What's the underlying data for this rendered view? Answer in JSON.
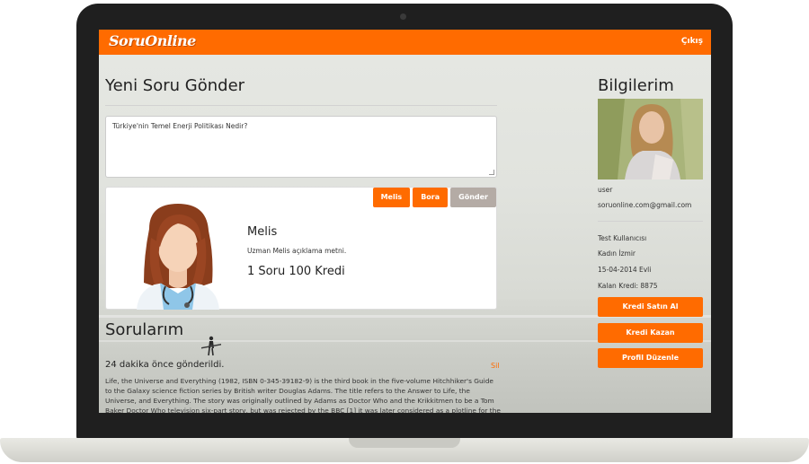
{
  "header": {
    "logo": "SoruOnline",
    "logout_label": "Çıkış"
  },
  "new_question": {
    "title": "Yeni Soru Gönder",
    "textarea_value": "Türkiye'nin Temel Enerji Politikası Nedir?",
    "expert_tabs": [
      "Melis",
      "Bora"
    ],
    "send_label": "Gönder"
  },
  "expert": {
    "name": "Melis",
    "description": "Uzman Melis açıklama metni.",
    "price": "1 Soru 100 Kredi"
  },
  "my_questions": {
    "title": "Sorularım",
    "items": [
      {
        "time": "24 dakika önce gönderildi.",
        "delete_label": "Sil",
        "body": "Life, the Universe and Everything (1982, ISBN 0-345-39182-9) is the third book in the five-volume Hitchhiker's Guide to the Galaxy science fiction series by British writer Douglas Adams. The title refers to the Answer to Life, the Universe, and Everything. The story was originally outlined by Adams as Doctor Who and the Krikkitmen to be a Tom Baker Doctor Who television six-part story, but was rejected by the BBC [1] it was later considered as a plotline for the"
      }
    ]
  },
  "profile": {
    "title": "Bilgilerim",
    "username": "user",
    "email": "soruonline.com@gmail.com",
    "full_name": "Test Kullanıcısı",
    "gender_city": "Kadın İzmir",
    "birth_marital": "15-04-2014 Evli",
    "credit": "Kalan Kredi: 8875",
    "buttons": {
      "buy_credit": "Kredi Satın Al",
      "earn_credit": "Kredi Kazan",
      "edit_profile": "Profil Düzenle"
    }
  },
  "colors": {
    "accent": "#ff6b00",
    "disabled_button": "#b4aba5"
  }
}
